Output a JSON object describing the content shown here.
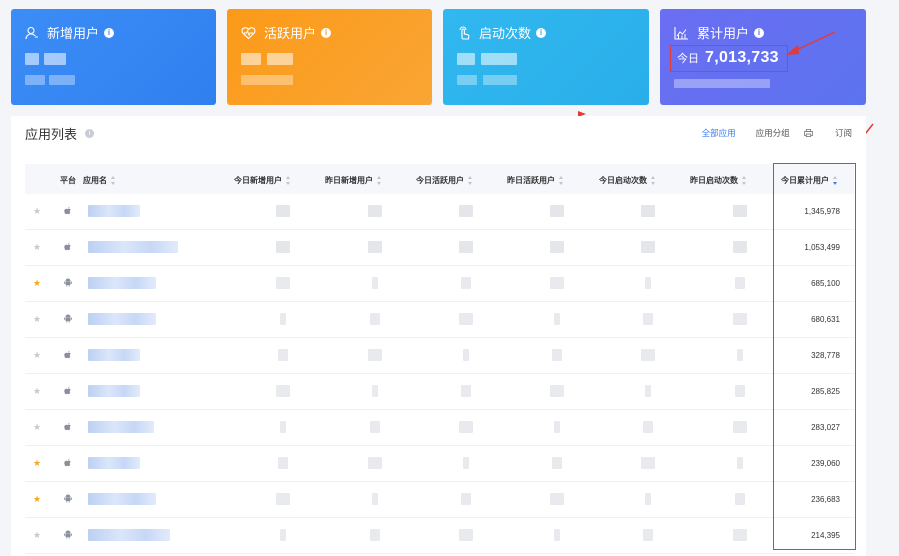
{
  "cards": [
    {
      "title": "新增用户",
      "icon": "user-icon",
      "bg": "#3e8ef6"
    },
    {
      "title": "活跃用户",
      "icon": "heart-pulse-icon",
      "bg": "#fa9e1e"
    },
    {
      "title": "启动次数",
      "icon": "pointer-icon",
      "bg": "#2db4ee"
    },
    {
      "title": "累计用户",
      "icon": "chart-icon",
      "bg": "#5f6cf0",
      "today_label": "今日",
      "today_value": "7,013,733"
    }
  ],
  "panel": {
    "title": "应用列表",
    "links": {
      "all": "全部应用",
      "group": "应用分组",
      "subscribe": "订阅"
    }
  },
  "table": {
    "headers": {
      "platform": "平台",
      "app_name": "应用名",
      "today_new": "今日新增用户",
      "yesterday_new": "昨日新增用户",
      "today_active": "今日活跃用户",
      "yesterday_active": "昨日活跃用户",
      "today_launch": "今日启动次数",
      "yesterday_launch": "昨日启动次数",
      "today_cumulative": "今日累计用户"
    },
    "rows": [
      {
        "starred": false,
        "platform": "ios",
        "cumulative": "1,345,978"
      },
      {
        "starred": false,
        "platform": "ios",
        "cumulative": "1,053,499"
      },
      {
        "starred": true,
        "platform": "android",
        "cumulative": "685,100"
      },
      {
        "starred": false,
        "platform": "android",
        "cumulative": "680,631"
      },
      {
        "starred": false,
        "platform": "ios",
        "cumulative": "328,778"
      },
      {
        "starred": false,
        "platform": "ios",
        "cumulative": "285,825"
      },
      {
        "starred": false,
        "platform": "ios",
        "cumulative": "283,027"
      },
      {
        "starred": true,
        "platform": "ios",
        "cumulative": "239,060"
      },
      {
        "starred": true,
        "platform": "android",
        "cumulative": "236,683"
      },
      {
        "starred": false,
        "platform": "android",
        "cumulative": "214,395"
      }
    ]
  },
  "colors": {
    "accent": "#3b7cf0",
    "annotation": "#e53935",
    "star": "#f5a623"
  }
}
